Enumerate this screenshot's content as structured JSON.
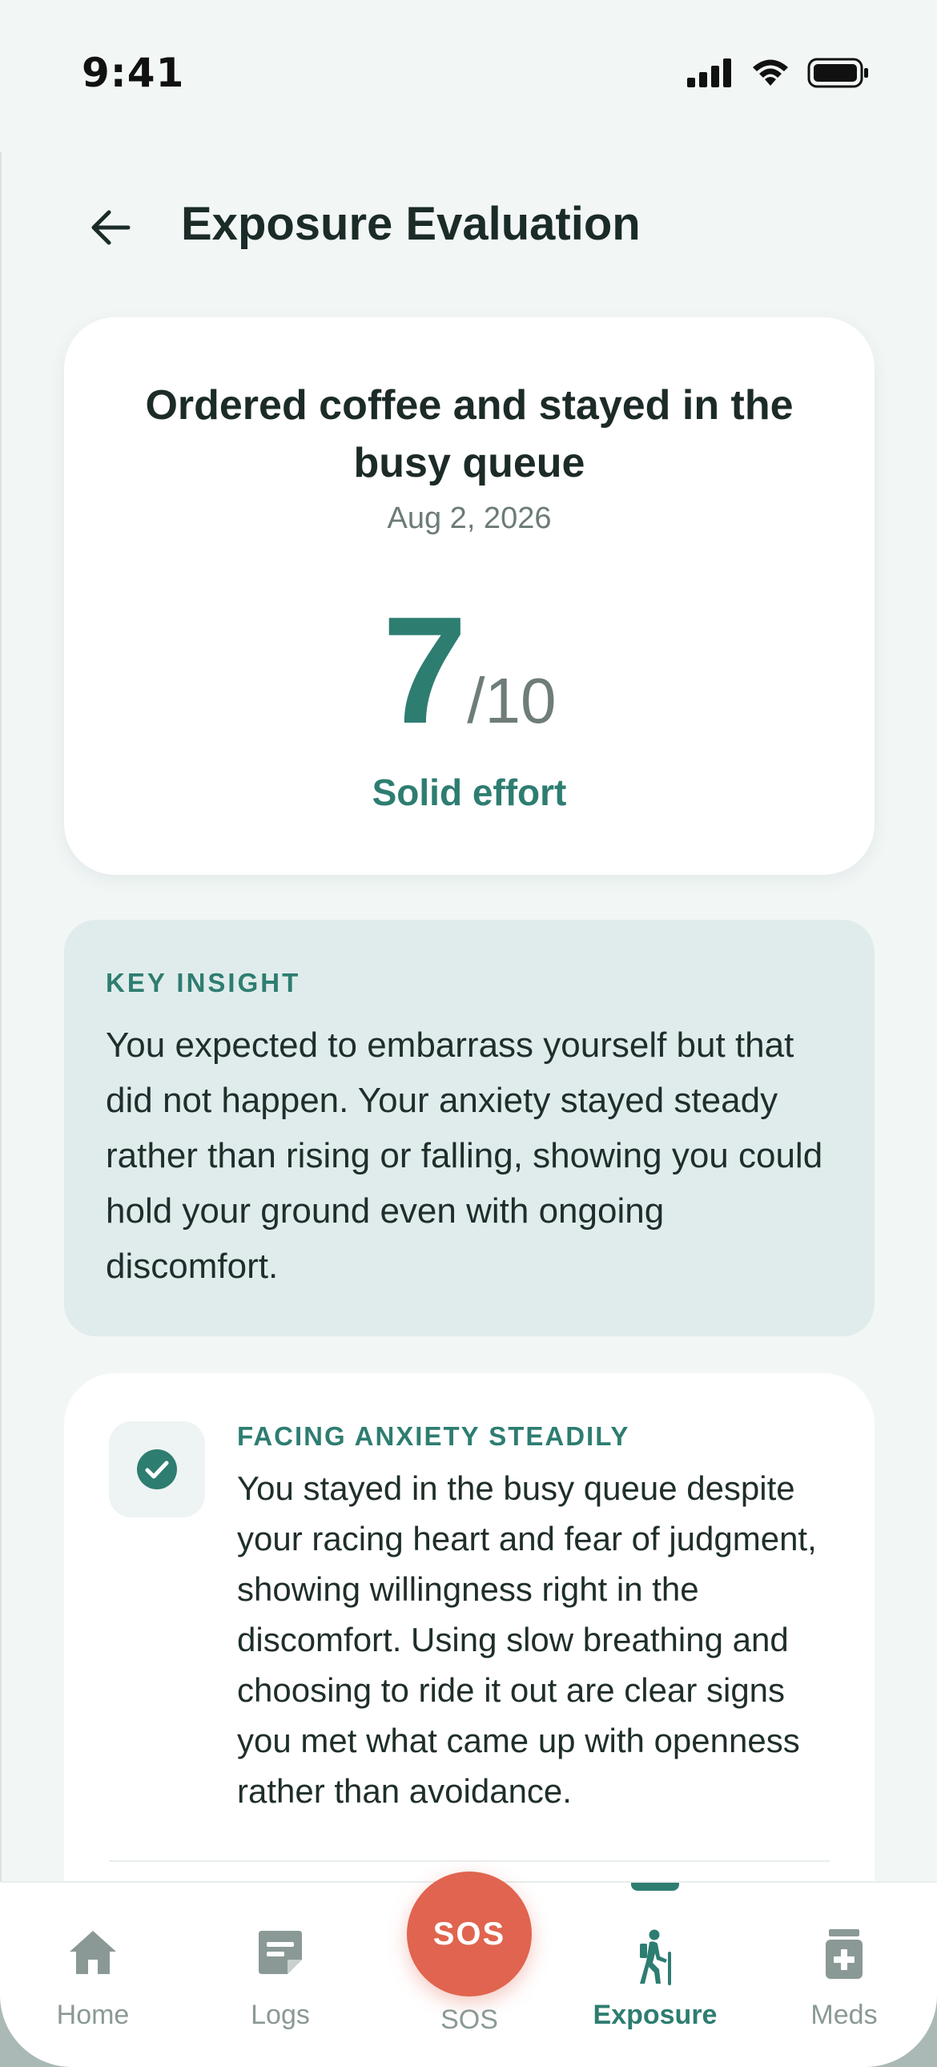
{
  "status_bar": {
    "time": "9:41",
    "icons": [
      "signal-icon",
      "wifi-icon",
      "battery-icon"
    ]
  },
  "header": {
    "back_icon": "arrow-left-icon",
    "title": "Exposure Evaluation"
  },
  "score_card": {
    "exposure_title": "Ordered coffee and stayed in the busy queue",
    "date": "Aug 2, 2026",
    "score": "7",
    "score_max": "/10",
    "verdict": "Solid effort"
  },
  "insight": {
    "label": "KEY INSIGHT",
    "text": "You expected to embarrass yourself but that did not happen. Your anxiety stayed steady rather than rising or falling, showing you could hold your ground even with ongoing discomfort."
  },
  "themes": [
    {
      "icon": "check-circle-icon",
      "label": "FACING ANXIETY STEADILY",
      "text": "You stayed in the busy queue despite your racing heart and fear of judgment, showing willingness right in the discomfort. Using slow breathing and choosing to ride it out are clear signs you met what came up with openness rather than avoidance."
    }
  ],
  "bottom_nav": {
    "items": [
      {
        "label": "Home",
        "icon": "home-icon",
        "active": false
      },
      {
        "label": "Logs",
        "icon": "logs-icon",
        "active": false
      },
      {
        "label": "Exposure",
        "icon": "hiker-icon",
        "active": true
      },
      {
        "label": "Meds",
        "icon": "medication-icon",
        "active": false
      }
    ],
    "sos": {
      "button_text": "SOS",
      "caption": "SOS"
    }
  },
  "colors": {
    "accent": "#2e7d71",
    "sos": "#e0644f",
    "background": "#f2f7f6",
    "insight_bg": "#e0eceb"
  }
}
